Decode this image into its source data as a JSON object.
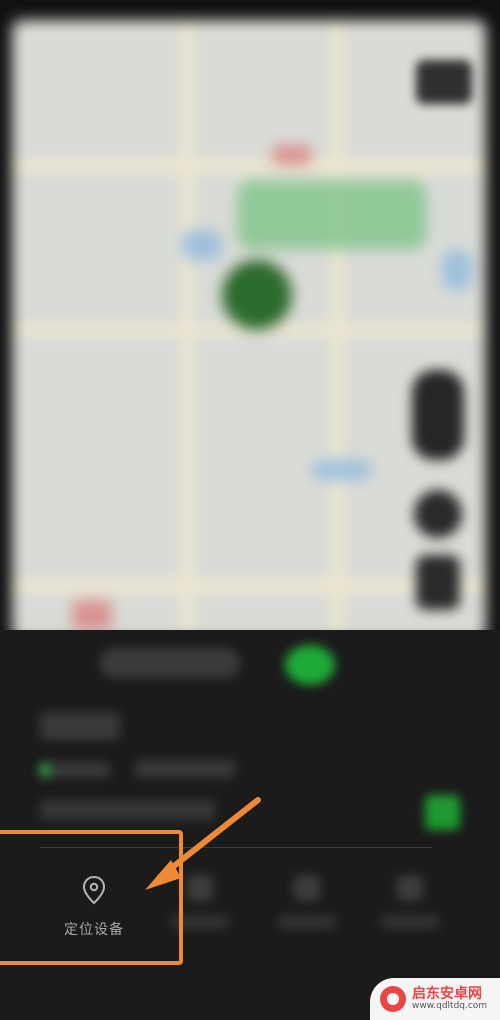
{
  "bottom_sheet": {
    "locate_device": {
      "label": "定位设备",
      "icon": "location-pin-icon"
    },
    "other_actions_count": 3
  },
  "annotation": {
    "highlight_color": "#ee8a35",
    "arrow_color": "#ee8a35"
  },
  "watermark": {
    "title": "启东安卓网",
    "url": "www.qdltdq.com",
    "accent": "#e24646"
  },
  "colors": {
    "status_green": "#1faa38",
    "background": "#111111"
  }
}
